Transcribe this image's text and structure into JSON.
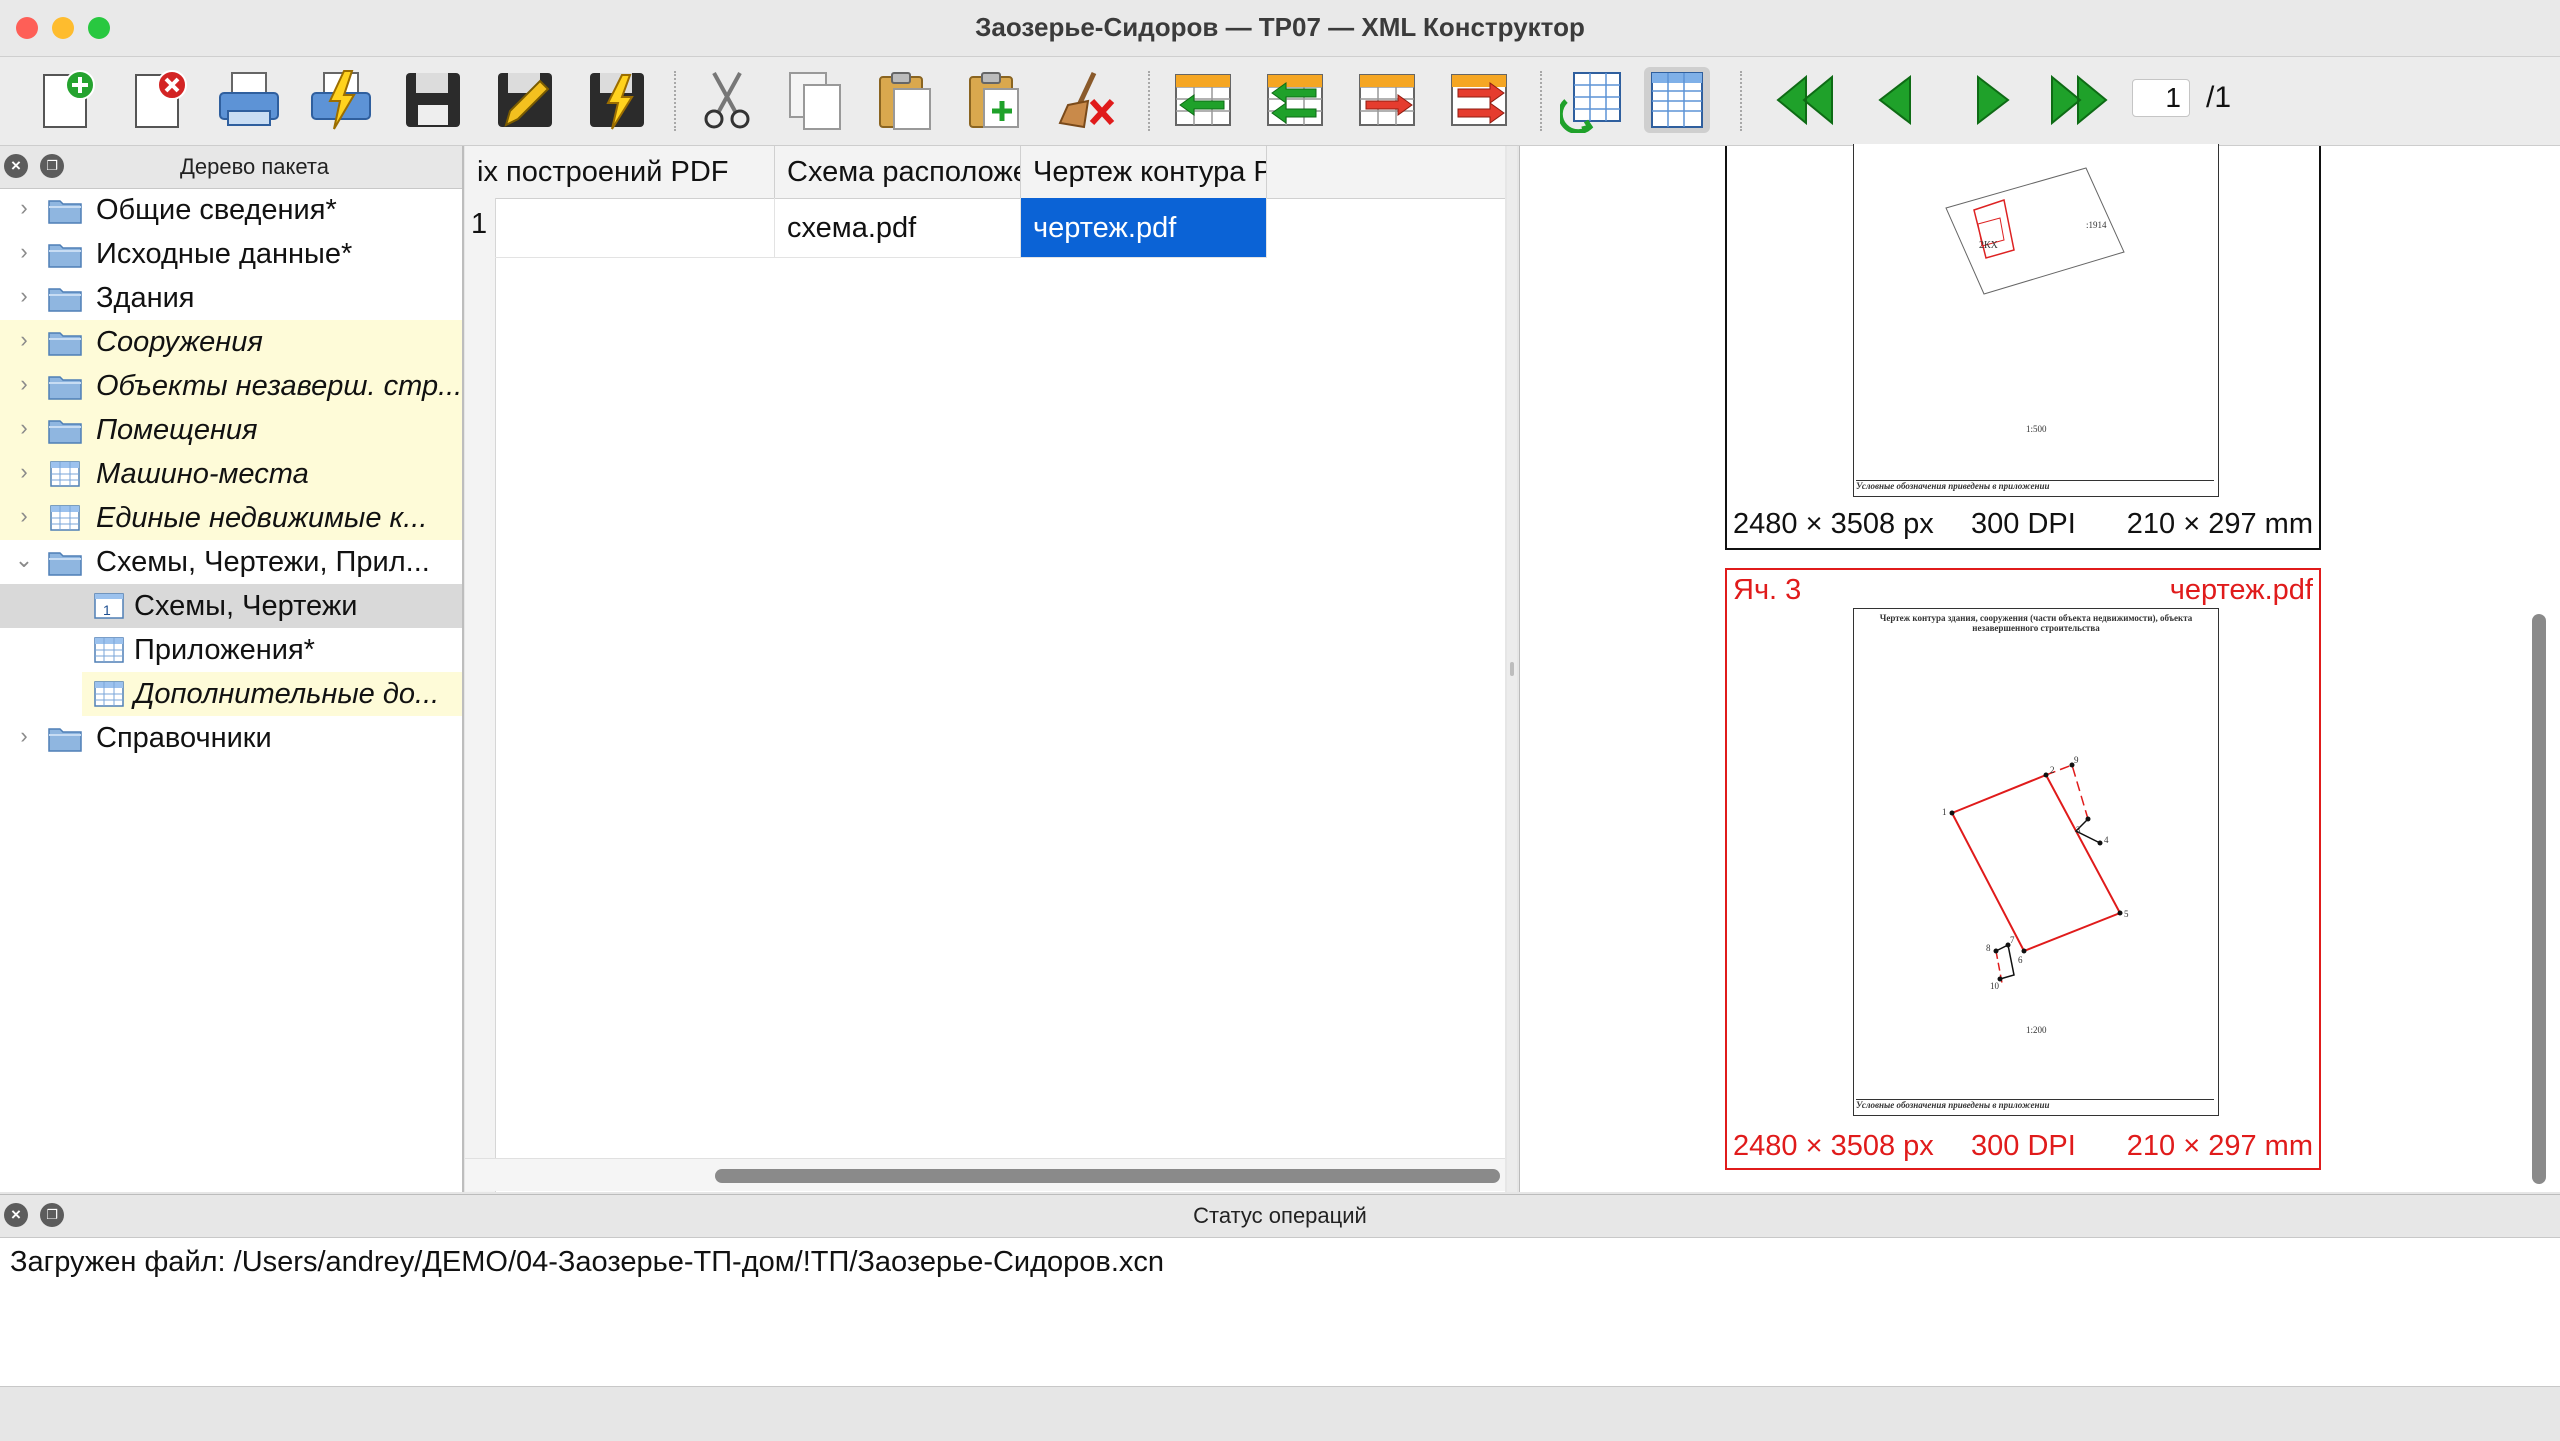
{
  "window": {
    "title": "Заозерье-Сидоров — ТР07 — XML Конструктор"
  },
  "toolbar": {
    "buttons": [
      {
        "name": "new-file",
        "icon": "new-document-icon"
      },
      {
        "name": "close-file",
        "icon": "delete-document-icon"
      },
      {
        "name": "print",
        "icon": "printer-icon"
      },
      {
        "name": "quick-print",
        "icon": "printer-lightning-icon"
      },
      {
        "name": "save",
        "icon": "floppy-icon"
      },
      {
        "name": "save-as",
        "icon": "floppy-pencil-icon"
      },
      {
        "name": "save-quick",
        "icon": "floppy-lightning-icon"
      },
      {
        "name": "cut",
        "icon": "scissors-icon"
      },
      {
        "name": "copy",
        "icon": "copy-icon"
      },
      {
        "name": "paste",
        "icon": "paste-icon"
      },
      {
        "name": "paste-add",
        "icon": "paste-add-icon"
      },
      {
        "name": "clear",
        "icon": "broom-icon"
      },
      {
        "name": "insert-row-before",
        "icon": "insert-row-left-icon"
      },
      {
        "name": "insert-row-after",
        "icon": "insert-row-left2-icon"
      },
      {
        "name": "move-row",
        "icon": "move-row-right-icon"
      },
      {
        "name": "delete-row",
        "icon": "delete-row-icon"
      },
      {
        "name": "refresh-table",
        "icon": "table-refresh-icon"
      },
      {
        "name": "table-view",
        "icon": "table-grid-icon"
      },
      {
        "name": "first-page",
        "icon": "double-left-arrow-icon"
      },
      {
        "name": "prev-page",
        "icon": "left-arrow-icon"
      },
      {
        "name": "next-page",
        "icon": "right-arrow-icon"
      },
      {
        "name": "last-page",
        "icon": "double-right-arrow-icon"
      }
    ],
    "page_current": "1",
    "page_total": "/1"
  },
  "tree": {
    "title": "Дерево пакета",
    "items": [
      {
        "label": "Общие сведения*",
        "level": 0,
        "icon": "folder-icon",
        "expanded": false,
        "highlight": false,
        "italic": false
      },
      {
        "label": "Исходные данные*",
        "level": 0,
        "icon": "folder-icon",
        "expanded": false,
        "highlight": false,
        "italic": false
      },
      {
        "label": "Здания",
        "level": 0,
        "icon": "folder-icon",
        "expanded": false,
        "highlight": false,
        "italic": false
      },
      {
        "label": "Сооружения",
        "level": 0,
        "icon": "folder-icon",
        "expanded": false,
        "highlight": true,
        "italic": true
      },
      {
        "label": "Объекты незаверш. стр...",
        "level": 0,
        "icon": "folder-icon",
        "expanded": false,
        "highlight": true,
        "italic": true
      },
      {
        "label": "Помещения",
        "level": 0,
        "icon": "folder-icon",
        "expanded": false,
        "highlight": true,
        "italic": true
      },
      {
        "label": "Машино-места",
        "level": 0,
        "icon": "table-icon",
        "expanded": false,
        "highlight": true,
        "italic": true
      },
      {
        "label": "Единые недвижимые к...",
        "level": 0,
        "icon": "table-icon",
        "expanded": false,
        "highlight": true,
        "italic": true
      },
      {
        "label": "Схемы, Чертежи, Прил...",
        "level": 0,
        "icon": "folder-icon",
        "expanded": true,
        "highlight": false,
        "italic": false
      },
      {
        "label": "Схемы, Чертежи",
        "level": 1,
        "icon": "numbered-table-icon",
        "highlight": false,
        "italic": false,
        "selected": true
      },
      {
        "label": "Приложения*",
        "level": 1,
        "icon": "table-icon",
        "highlight": false,
        "italic": false
      },
      {
        "label": "Дополнительные до...",
        "level": 1,
        "icon": "table-icon",
        "highlight": true,
        "italic": true
      },
      {
        "label": "Справочники",
        "level": 0,
        "icon": "folder-icon",
        "expanded": false,
        "highlight": false,
        "italic": false
      }
    ]
  },
  "table": {
    "columns": [
      "іх построений PDF",
      "Схема расположения PDF",
      "Чертеж контура PDF"
    ],
    "rows": [
      {
        "num": "1",
        "cells": [
          "",
          "схема.pdf",
          "чертеж.pdf"
        ]
      }
    ]
  },
  "preview": {
    "card1": {
      "size_px": "2480 × 3508 px",
      "dpi": "300 DPI",
      "size_mm": "210 × 297 mm",
      "legend": "Условные обозначения приведены в приложении",
      "scale": "1:500",
      "label1": "2КХ",
      "label2": ":1914"
    },
    "card2": {
      "cell": "Яч. 3",
      "file": "чертеж.pdf",
      "size_px": "2480 × 3508 px",
      "dpi": "300 DPI",
      "size_mm": "210 × 297 mm",
      "heading": "Чертеж контура здания, сооружения (части объекта недвижимости), объекта незавершенного строительства",
      "legend": "Условные обозначения приведены в приложении",
      "scale": "1:200",
      "points": [
        "1",
        "2",
        "3",
        "4",
        "5",
        "6",
        "7",
        "8",
        "9",
        "10"
      ]
    }
  },
  "status": {
    "title": "Статус операций",
    "message": "Загружен файл: /Users/andrey/ДЕМО/04-Заозерье-ТП-дом/!ТП/Заозерье-Сидоров.xcn"
  },
  "colors": {
    "selection": "#0b63d6",
    "highlight": "#fefbd8",
    "accent_red": "#e01b1b",
    "arrow_green": "#1fa12a"
  }
}
